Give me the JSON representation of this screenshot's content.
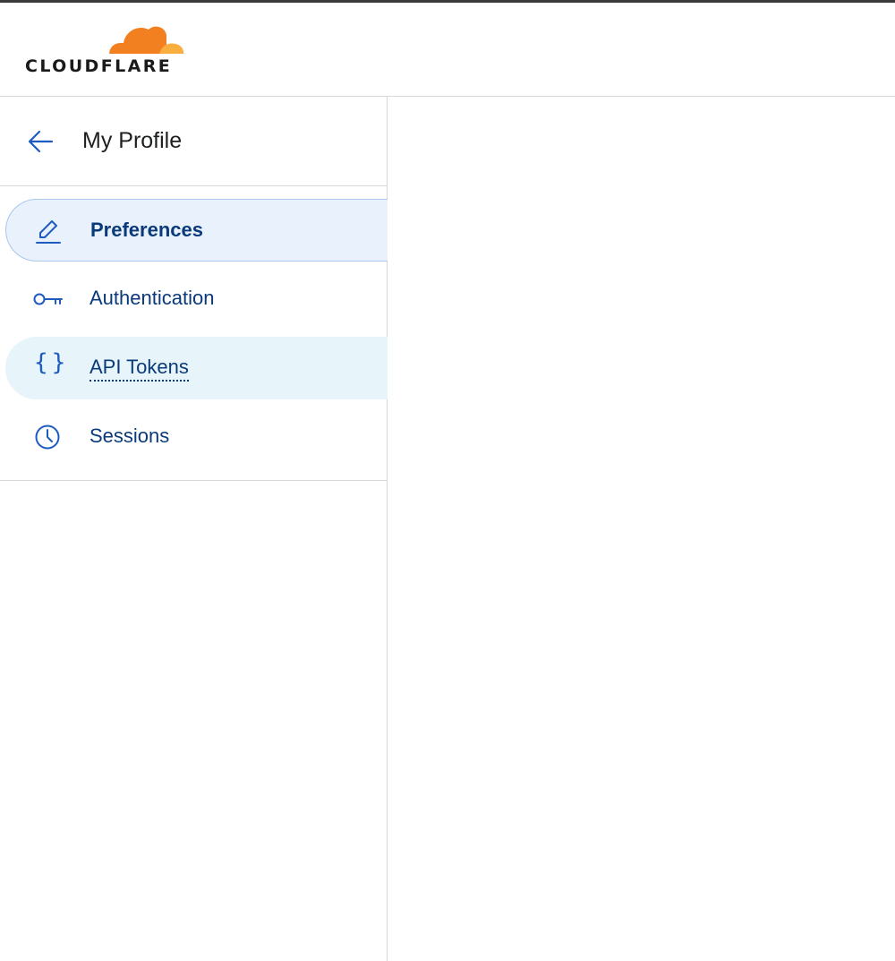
{
  "brand": {
    "logo_text": "CLOUDFLARE",
    "cloud_colors": [
      "#f38020",
      "#faae40"
    ]
  },
  "profile": {
    "title": "My Profile"
  },
  "nav": {
    "items": [
      {
        "label": "Preferences",
        "icon": "pencil-icon",
        "state": "active"
      },
      {
        "label": "Authentication",
        "icon": "key-icon",
        "state": "default"
      },
      {
        "label": "API Tokens",
        "icon": "braces-icon",
        "state": "hover"
      },
      {
        "label": "Sessions",
        "icon": "clock-icon",
        "state": "default"
      }
    ]
  },
  "colors": {
    "accent": "#1d5bbf",
    "nav_text": "#0b3a7a",
    "active_bg": "#e8f1fc",
    "hover_bg": "#e7f4fa"
  }
}
